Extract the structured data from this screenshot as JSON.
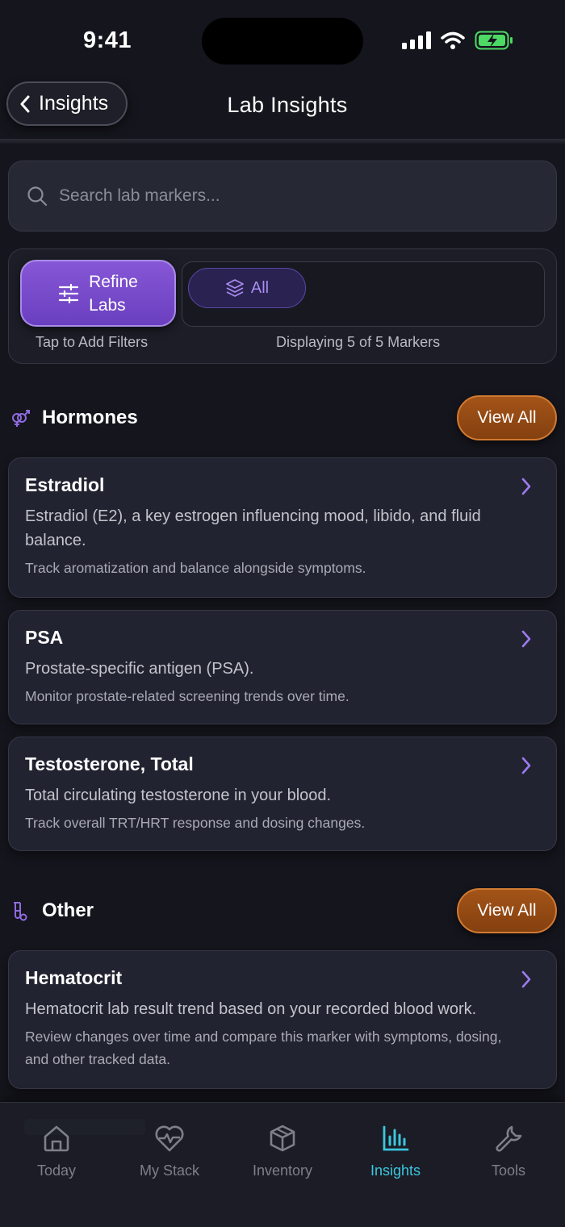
{
  "status_bar": {
    "time": "9:41"
  },
  "header": {
    "back_label": "Insights",
    "title": "Lab Insights"
  },
  "search": {
    "placeholder": "Search lab markers..."
  },
  "filters": {
    "refine_line1": "Refine",
    "refine_line2": "Labs",
    "chip_all": "All",
    "tap_caption": "Tap to Add Filters",
    "display_caption": "Displaying 5 of 5 Markers"
  },
  "sections": [
    {
      "title": "Hormones",
      "view_all": "View All",
      "cards": [
        {
          "title": "Estradiol",
          "desc": "Estradiol (E2), a key estrogen influencing mood, libido, and fluid balance.",
          "note": "Track aromatization and balance alongside symptoms."
        },
        {
          "title": "PSA",
          "desc": "Prostate-specific antigen (PSA).",
          "note": "Monitor prostate-related screening trends over time."
        },
        {
          "title": "Testosterone, Total",
          "desc": "Total circulating testosterone in your blood.",
          "note": "Track overall TRT/HRT response and dosing changes."
        }
      ]
    },
    {
      "title": "Other",
      "view_all": "View All",
      "cards": [
        {
          "title": "Hematocrit",
          "desc": "Hematocrit lab result trend based on your recorded blood work.",
          "note": "Review changes over time and compare this marker with symptoms, dosing, and other tracked data."
        }
      ]
    }
  ],
  "nav": [
    {
      "label": "Today",
      "icon": "home-icon",
      "active": false
    },
    {
      "label": "My Stack",
      "icon": "heart-pulse-icon",
      "active": false
    },
    {
      "label": "Inventory",
      "icon": "box-icon",
      "active": false
    },
    {
      "label": "Insights",
      "icon": "bar-chart-icon",
      "active": true
    },
    {
      "label": "Tools",
      "icon": "wrench-icon",
      "active": false
    }
  ],
  "colors": {
    "background": "#15151d",
    "accent_purple": "#7b4cd0",
    "accent_orange": "#a35418",
    "active_tab": "#3bc6df",
    "battery_green": "#4cd964"
  }
}
